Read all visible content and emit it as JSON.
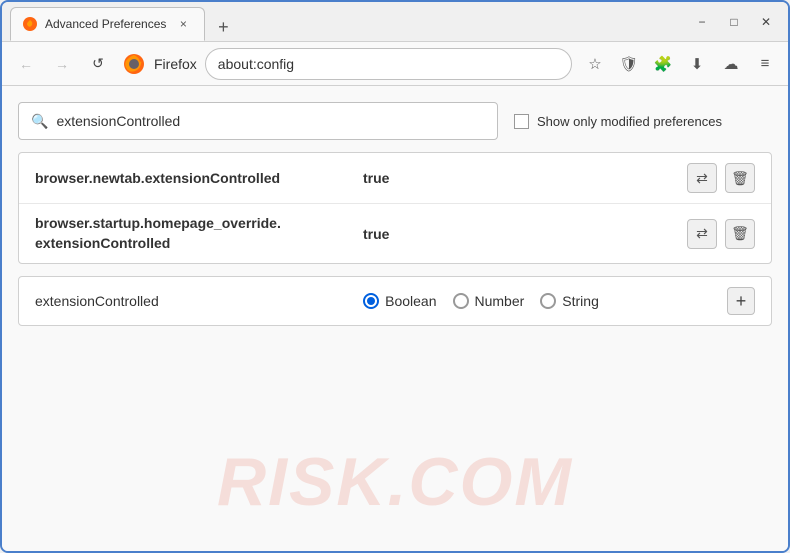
{
  "window": {
    "title": "Advanced Preferences",
    "tab_close_label": "×",
    "new_tab_label": "+",
    "win_minimize": "−",
    "win_maximize": "□",
    "win_close": "✕"
  },
  "nav": {
    "back_label": "←",
    "forward_label": "→",
    "reload_label": "↺",
    "browser_name": "Firefox",
    "address": "about:config",
    "bookmark_icon": "☆",
    "shield_icon": "🛡",
    "extension_icon": "🧩",
    "download_icon": "⬇",
    "account_icon": "☁",
    "menu_icon": "≡"
  },
  "toolbar": {
    "search_placeholder": "extensionControlled",
    "search_value": "extensionControlled",
    "checkbox_label": "Show only modified preferences"
  },
  "results": [
    {
      "name": "browser.newtab.extensionControlled",
      "value": "true",
      "multiline": false
    },
    {
      "name_line1": "browser.startup.homepage_override.",
      "name_line2": "extensionControlled",
      "value": "true",
      "multiline": true
    }
  ],
  "add_pref": {
    "name": "extensionControlled",
    "types": [
      {
        "label": "Boolean",
        "selected": true
      },
      {
        "label": "Number",
        "selected": false
      },
      {
        "label": "String",
        "selected": false
      }
    ],
    "add_label": "+"
  },
  "watermark": "RISK.COM"
}
